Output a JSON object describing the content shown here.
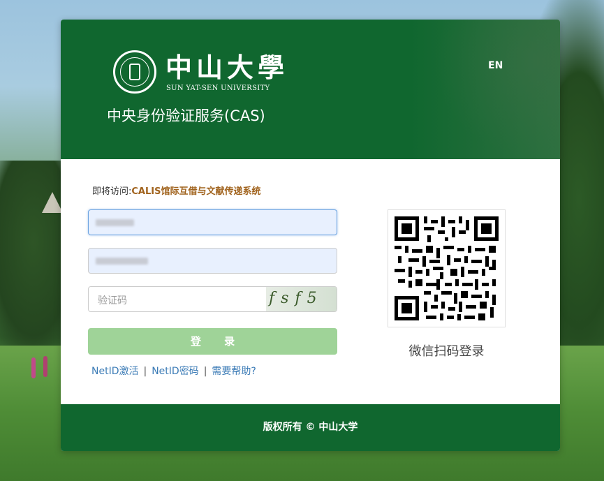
{
  "header": {
    "university_cn": "中山大學",
    "university_en": "SUN YAT-SEN UNIVERSITY",
    "service_title": "中央身份验证服务(CAS)",
    "language_toggle": "EN"
  },
  "visit": {
    "prefix": "即将访问:",
    "target": "CALIS馆际互借与文献传递系统"
  },
  "form": {
    "captcha_placeholder": "验证码",
    "captcha_text": "fsf5",
    "login_label": "登 录"
  },
  "links": [
    {
      "label": "NetID激活"
    },
    {
      "label": "NetID密码"
    },
    {
      "label": "需要帮助?"
    }
  ],
  "link_separator": "|",
  "qr": {
    "label": "微信扫码登录"
  },
  "footer": {
    "copyright": "版权所有 © 中山大学"
  },
  "colors": {
    "brand_green": "#10672f",
    "button_green": "#9fd398",
    "link_blue": "#3b7bb6",
    "visit_target": "#a0621c"
  }
}
